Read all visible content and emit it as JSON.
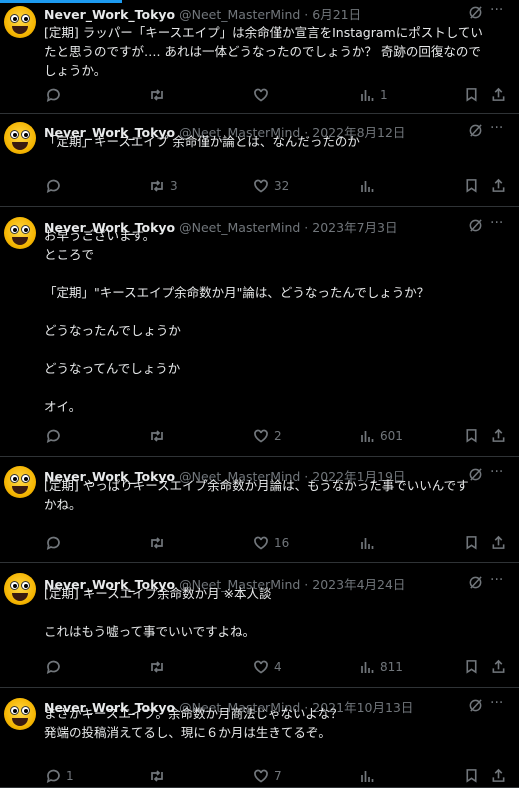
{
  "tweets": [
    {
      "name": "Never_Work_Tokyo",
      "handle": "@Neet_MasterMind",
      "date": "6月21日",
      "lines": [
        "[定期] ラッパー「キースエイプ」は余命僅か宣言をInstagramにポストしてい",
        "たと思うのですが…. あれは一体どうなったのでしょうか？ 奇跡の回復なので",
        "しょうか。"
      ],
      "replies": "",
      "retweets": "",
      "likes": "",
      "views": "1"
    },
    {
      "name": "Never_Work_Tokyo",
      "handle": "@Neet_MasterMind",
      "date": "2022年8月12日",
      "lines": [
        "「定期」キースエイプ 余命僅か論とは、なんだったのか"
      ],
      "replies": "",
      "retweets": "3",
      "likes": "32",
      "views": ""
    },
    {
      "name": "Never_Work_Tokyo",
      "handle": "@Neet_MasterMind",
      "date": "2023年7月3日",
      "lines": [
        "お早うございます。",
        "ところで",
        "",
        "「定期」\"キースエイプ余命数か月\"論は、どうなったんでしょうか？",
        "",
        "どうなったんでしょうか",
        "",
        "どうなってんでしょうか",
        "",
        "オイ。"
      ],
      "replies": "",
      "retweets": "",
      "likes": "2",
      "views": "601"
    },
    {
      "name": "Never_Work_Tokyo",
      "handle": "@Neet_MasterMind",
      "date": "2022年1月19日",
      "lines": [
        "[定期] やっぱりキースエイプ余命数か月論は、もうなかった事でいいんです",
        "かね。"
      ],
      "replies": "",
      "retweets": "",
      "likes": "16",
      "views": ""
    },
    {
      "name": "Never_Work_Tokyo",
      "handle": "@Neet_MasterMind",
      "date": "2023年4月24日",
      "lines": [
        "[定期] キースエイプ余命数か月 ※本人談",
        "",
        "これはもう嘘って事でいいですよね。"
      ],
      "replies": "",
      "retweets": "",
      "likes": "4",
      "views": "811"
    },
    {
      "name": "Never_Work_Tokyo",
      "handle": "@Neet_MasterMind",
      "date": "2021年10月13日",
      "lines": [
        "まさかキースエイプ。余命数か月商法じゃないよな？",
        "発端の投稿消えてるし、現に６か月は生きてるぞ。"
      ],
      "replies": "1",
      "retweets": "",
      "likes": "7",
      "views": ""
    }
  ],
  "header": {
    "separator": "·",
    "more": "···"
  },
  "icons": [
    "grok-icon",
    "more-icon",
    "reply-icon",
    "retweet-icon",
    "like-icon",
    "views-icon",
    "bookmark-icon",
    "share-icon"
  ],
  "colors": {
    "background": "#000000",
    "text": "#e7e9ea",
    "muted": "#71767b",
    "divider": "#2f3336",
    "accent": "#1d9bf0"
  }
}
